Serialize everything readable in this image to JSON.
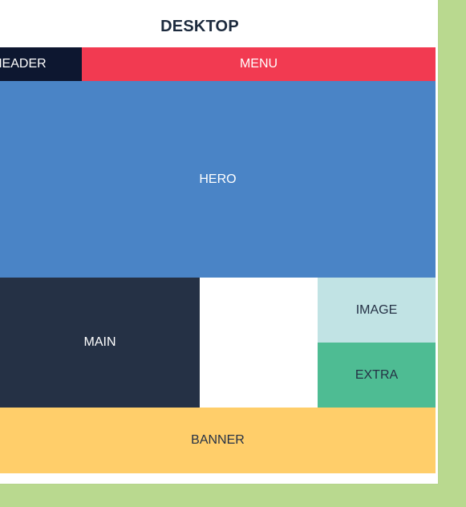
{
  "diagram": {
    "title": "DESKTOP",
    "blocks": {
      "header": {
        "label": "HEADER",
        "color": "#0d1730"
      },
      "menu": {
        "label": "MENU",
        "color": "#f23a51"
      },
      "hero": {
        "label": "HERO",
        "color": "#4a84c6"
      },
      "main": {
        "label": "MAIN",
        "color": "#253145"
      },
      "empty": {
        "label": "",
        "color": "#ffffff"
      },
      "image": {
        "label": "IMAGE",
        "color": "#c1e3e4"
      },
      "extra": {
        "label": "EXTRA",
        "color": "#4ebc93"
      },
      "banner": {
        "label": "BANNER",
        "color": "#ffce6a"
      }
    }
  }
}
